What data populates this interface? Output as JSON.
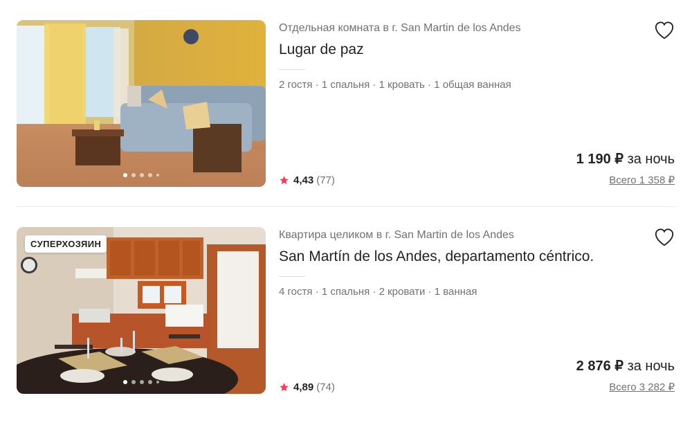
{
  "listings": [
    {
      "subtitle": "Отдельная комната в г. San Martin de los Andes",
      "title": "Lugar de paz",
      "details": "2 гостя · 1 спальня · 1 кровать · 1 общая ванная",
      "rating": "4,43",
      "reviews": "(77)",
      "price": "1 190 ₽",
      "price_unit": "за ночь",
      "total": "Всего 1 358 ₽",
      "badge": null
    },
    {
      "subtitle": "Квартира целиком в г. San Martin de los Andes",
      "title": "San Martín de los Andes, departamento céntrico.",
      "details": "4 гостя · 1 спальня · 2 кровати · 1 ванная",
      "rating": "4,89",
      "reviews": "(74)",
      "price": "2 876 ₽",
      "price_unit": "за ночь",
      "total": "Всего 3 282 ₽",
      "badge": "СУПЕРХОЗЯИН"
    }
  ],
  "colors": {
    "accent_star": "#FF385C",
    "text_primary": "#222222",
    "text_secondary": "#717171"
  },
  "icons": {
    "favorite": "heart-outline-icon",
    "rating": "star-icon"
  }
}
